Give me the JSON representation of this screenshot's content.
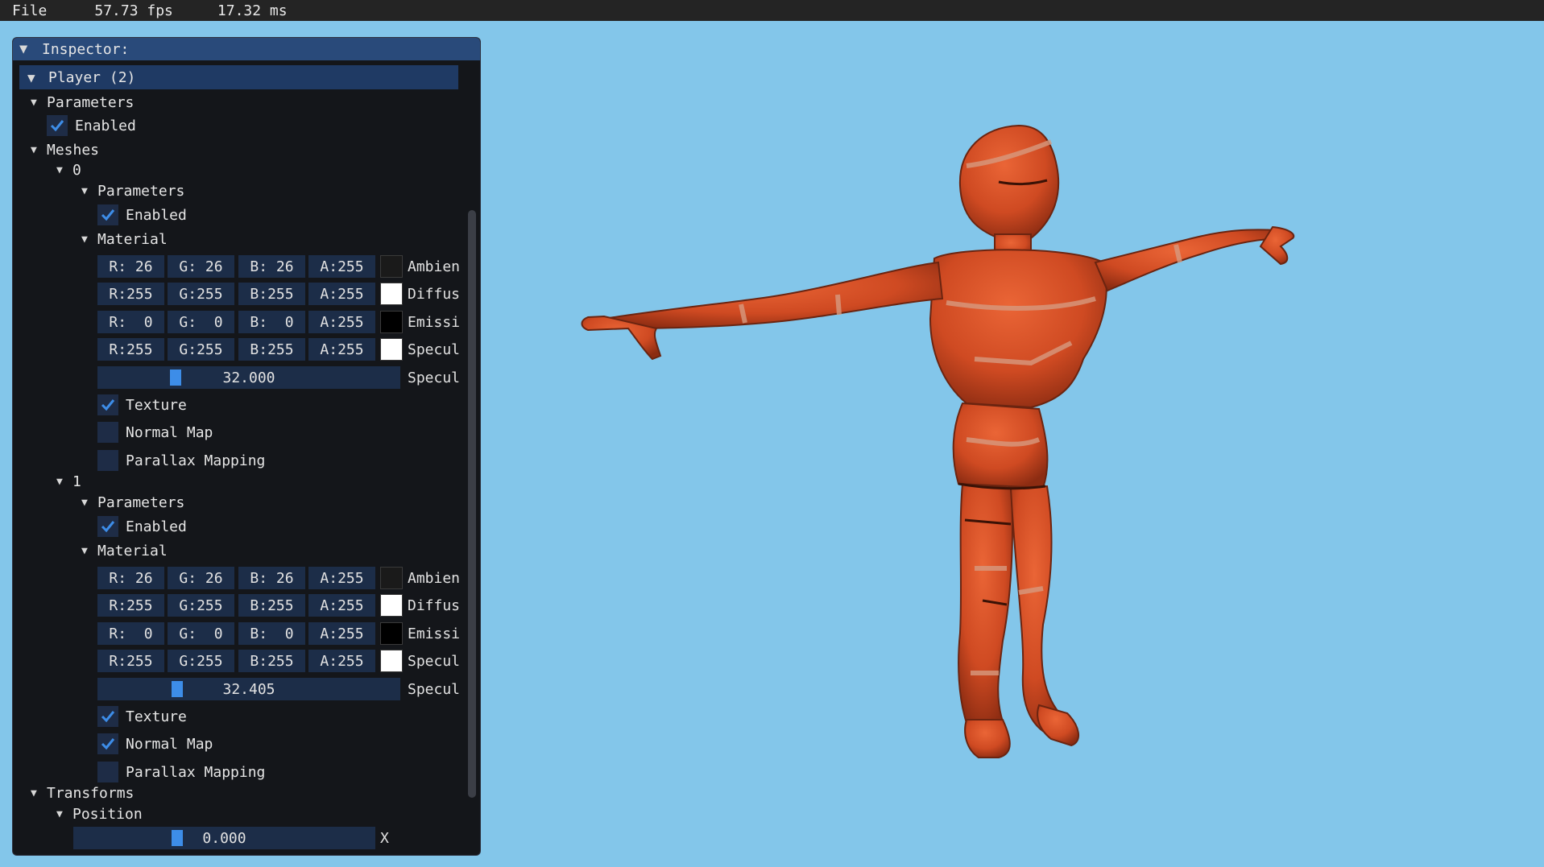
{
  "menubar": {
    "file": "File",
    "fps": "57.73 fps",
    "ms": "17.32 ms"
  },
  "inspector": {
    "title": "Inspector:",
    "object": "Player (2)",
    "parameters_label": "Parameters",
    "enabled_label": "Enabled",
    "enabled": true,
    "meshes_label": "Meshes",
    "meshes": [
      {
        "index": "0",
        "parameters_label": "Parameters",
        "enabled_label": "Enabled",
        "enabled": true,
        "material_label": "Material",
        "colors": [
          {
            "r": "R: 26",
            "g": "G: 26",
            "b": "B: 26",
            "a": "A:255",
            "swatch": "#1a1a1a",
            "label": "Ambien"
          },
          {
            "r": "R:255",
            "g": "G:255",
            "b": "B:255",
            "a": "A:255",
            "swatch": "#ffffff",
            "label": "Diffus"
          },
          {
            "r": "R:  0",
            "g": "G:  0",
            "b": "B:  0",
            "a": "A:255",
            "swatch": "#000000",
            "label": "Emissi"
          },
          {
            "r": "R:255",
            "g": "G:255",
            "b": "B:255",
            "a": "A:255",
            "swatch": "#ffffff",
            "label": "Specul"
          }
        ],
        "shininess_value": "32.000",
        "shininess_fraction": 0.25,
        "shininess_label": "Specul",
        "options": [
          {
            "label": "Texture",
            "checked": true
          },
          {
            "label": "Normal Map",
            "checked": false
          },
          {
            "label": "Parallax Mapping",
            "checked": false
          }
        ]
      },
      {
        "index": "1",
        "parameters_label": "Parameters",
        "enabled_label": "Enabled",
        "enabled": true,
        "material_label": "Material",
        "colors": [
          {
            "r": "R: 26",
            "g": "G: 26",
            "b": "B: 26",
            "a": "A:255",
            "swatch": "#1a1a1a",
            "label": "Ambien"
          },
          {
            "r": "R:255",
            "g": "G:255",
            "b": "B:255",
            "a": "A:255",
            "swatch": "#ffffff",
            "label": "Diffus"
          },
          {
            "r": "R:  0",
            "g": "G:  0",
            "b": "B:  0",
            "a": "A:255",
            "swatch": "#000000",
            "label": "Emissi"
          },
          {
            "r": "R:255",
            "g": "G:255",
            "b": "B:255",
            "a": "A:255",
            "swatch": "#ffffff",
            "label": "Specul"
          }
        ],
        "shininess_value": "32.405",
        "shininess_fraction": 0.26,
        "shininess_label": "Specul",
        "options": [
          {
            "label": "Texture",
            "checked": true
          },
          {
            "label": "Normal Map",
            "checked": true
          },
          {
            "label": "Parallax Mapping",
            "checked": false
          }
        ]
      }
    ],
    "transforms_label": "Transforms",
    "position_label": "Position",
    "position_x_value": "0.000",
    "position_x_fraction": 0.34,
    "position_x_label": "X"
  },
  "viewport": {
    "background": "#83c6ea",
    "model_color": "#cf4a22"
  }
}
